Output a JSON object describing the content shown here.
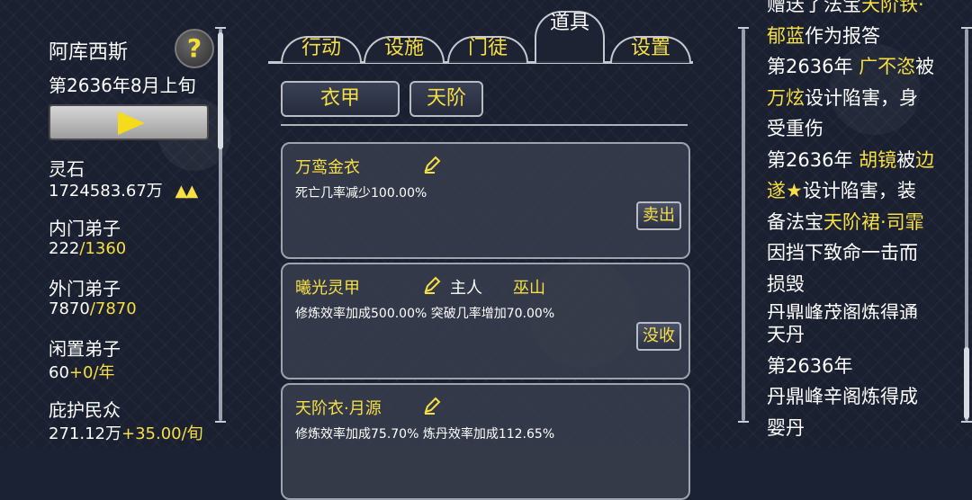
{
  "left": {
    "sect_name": "阿库西斯",
    "date": "第2636年8月上旬",
    "help_icon_label": "?",
    "stats": {
      "spirit_stone_label": "灵石",
      "spirit_stone_value": "1724583.67万",
      "spirit_stone_trend": "▲▲",
      "inner_label": "内门弟子",
      "inner_current": "222",
      "inner_max": "/1360",
      "outer_label": "外门弟子",
      "outer_current": "7870",
      "outer_max": "/7870",
      "idle_label": "闲置弟子",
      "idle_current": "60",
      "idle_rate": "+0/年",
      "people_label": "庇护民众",
      "people_current": "271.12万",
      "people_rate": "+35.00/旬"
    }
  },
  "tabs": [
    {
      "label": "行动",
      "active": false
    },
    {
      "label": "设施",
      "active": false
    },
    {
      "label": "门徒",
      "active": false
    },
    {
      "label": "道具",
      "active": true
    },
    {
      "label": "设置",
      "active": false
    }
  ],
  "subtabs": [
    {
      "label": "衣甲"
    },
    {
      "label": "天阶"
    }
  ],
  "items": [
    {
      "name": "万鸾金衣",
      "owner_label": "",
      "owner": "",
      "desc": "死亡几率减少100.00%",
      "desc2": "",
      "action": "卖出"
    },
    {
      "name": "曦光灵甲",
      "owner_label": "主人",
      "owner": "巫山",
      "desc": "修炼效率加成500.00% 突破几率增加70.00%",
      "desc2": "",
      "action": "没收"
    },
    {
      "name": "天阶衣·月源",
      "owner_label": "",
      "owner": "",
      "desc": "修炼效率加成75.70% 炼丹效率加成112.65%",
      "desc2": "",
      "action": ""
    }
  ],
  "log": {
    "line0a": "赠送了法宝",
    "line0b": "天阶铁·",
    "line1a": "郁蓝",
    "line1b": "作为报答",
    "e1_year": "第2636年 ",
    "e1_name1": "广不恣",
    "e1_t1": "被",
    "e1_name2": "万炫",
    "e1_t2": "设计陷害，身",
    "e1_t3": "受重伤",
    "e2_year": "第2636年 ",
    "e2_name1": "胡镜",
    "e2_t1": "被",
    "e2_name2a": "边",
    "e2_name2b": "遂★",
    "e2_t2": "设计陷害，装",
    "e2_t3": "备法宝",
    "e2_item": "天阶裙·司霏",
    "e2_t4": "因挡下致命一击而",
    "e2_t5": "损毁",
    "e3_partial": "丹鼎峰茂阁炼得通",
    "e3_t1": "天丹",
    "e4_year": "第2636年",
    "e4_t1": "丹鼎峰辛阁炼得成",
    "e4_t2": "婴丹"
  }
}
